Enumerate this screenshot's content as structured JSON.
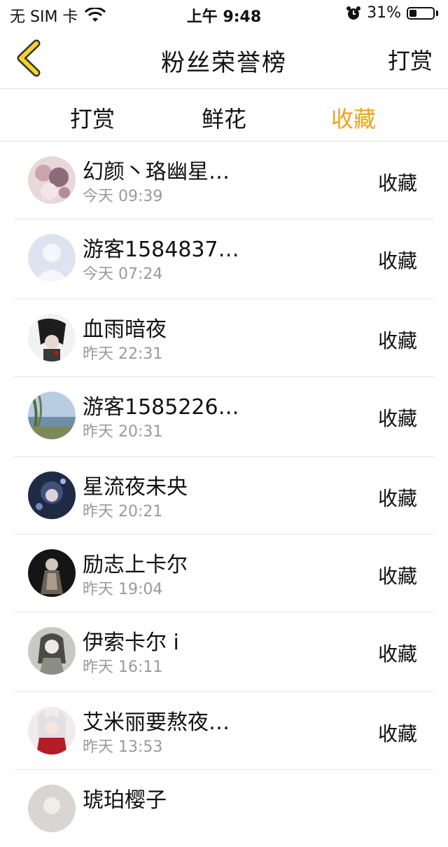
{
  "status_bar": {
    "carrier": "无 SIM 卡",
    "time": "上午 9:48",
    "battery": "31%",
    "battery_level": 0.31
  },
  "nav": {
    "title": "粉丝荣誉榜",
    "right": "打赏"
  },
  "tabs": [
    {
      "label": "打赏",
      "active": false
    },
    {
      "label": "鲜花",
      "active": false
    },
    {
      "label": "收藏",
      "active": true
    }
  ],
  "accent_color": "#f0a21c",
  "list": [
    {
      "name": "幻颜丶珞幽星…",
      "time": "今天 09:39",
      "action": "收藏",
      "avatar": "avatar-flowers"
    },
    {
      "name": "游客1584837…",
      "time": "今天 07:24",
      "action": "收藏",
      "avatar": "avatar-default"
    },
    {
      "name": "血雨暗夜",
      "time": "昨天 22:31",
      "action": "收藏",
      "avatar": "avatar-anime-dark"
    },
    {
      "name": "游客1585226…",
      "time": "昨天 20:31",
      "action": "收藏",
      "avatar": "avatar-lake"
    },
    {
      "name": "星流夜未央",
      "time": "昨天 20:21",
      "action": "收藏",
      "avatar": "avatar-night"
    },
    {
      "name": "励志上卡尔",
      "time": "昨天 19:04",
      "action": "收藏",
      "avatar": "avatar-figure"
    },
    {
      "name": "伊索卡尔 i",
      "time": "昨天 16:11",
      "action": "收藏",
      "avatar": "avatar-sketch"
    },
    {
      "name": "艾米丽要熬夜…",
      "time": "昨天 13:53",
      "action": "收藏",
      "avatar": "avatar-red"
    },
    {
      "name": "琥珀樱子",
      "time": "",
      "action": "",
      "avatar": "avatar-partial"
    }
  ]
}
